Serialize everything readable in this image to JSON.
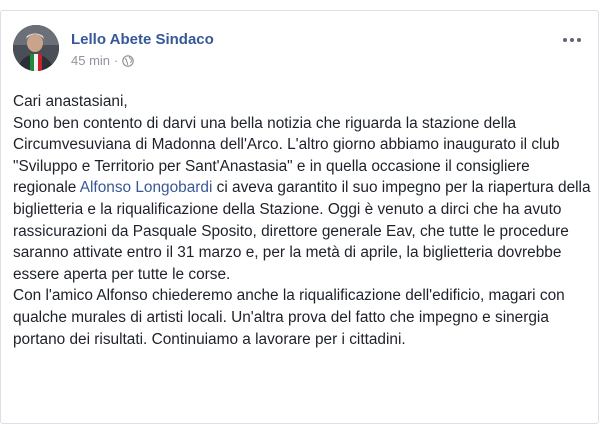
{
  "post": {
    "author": "Lello Abete Sindaco",
    "time": "45 min",
    "separator": "·",
    "privacy_icon": "globe-icon",
    "more_icon": "more-options-icon",
    "greeting": "Cari anastasiani,",
    "para1_before_link": "Sono ben contento di darvi una bella notizia che riguarda la stazione della Circumvesuviana di Madonna dell'Arco. L'altro giorno abbiamo inaugurato il club \"Sviluppo e Territorio per Sant'Anastasia\" e in quella occasione il consigliere regionale ",
    "link_text": "Alfonso Longobardi",
    "para1_after_link": " ci aveva garantito il suo impegno per la riapertura della biglietteria e la riqualificazione della Stazione. Oggi è venuto a dirci che ha avuto rassicurazioni da Pasquale Sposito, direttore generale Eav, che tutte le procedure saranno attivate entro il 31 marzo e, per la metà di aprile, la biglietteria dovrebbe essere aperta per tutte le corse.",
    "para2": "Con l'amico Alfonso chiederemo anche la riqualificazione dell'edificio, magari con qualche murales di artisti locali. Un'altra prova del fatto che impegno e sinergia portano dei risultati. Continuiamo a lavorare per i cittadini."
  },
  "colors": {
    "author": "#365899",
    "link": "#385898",
    "text": "#1d2129",
    "meta": "#90949c"
  }
}
